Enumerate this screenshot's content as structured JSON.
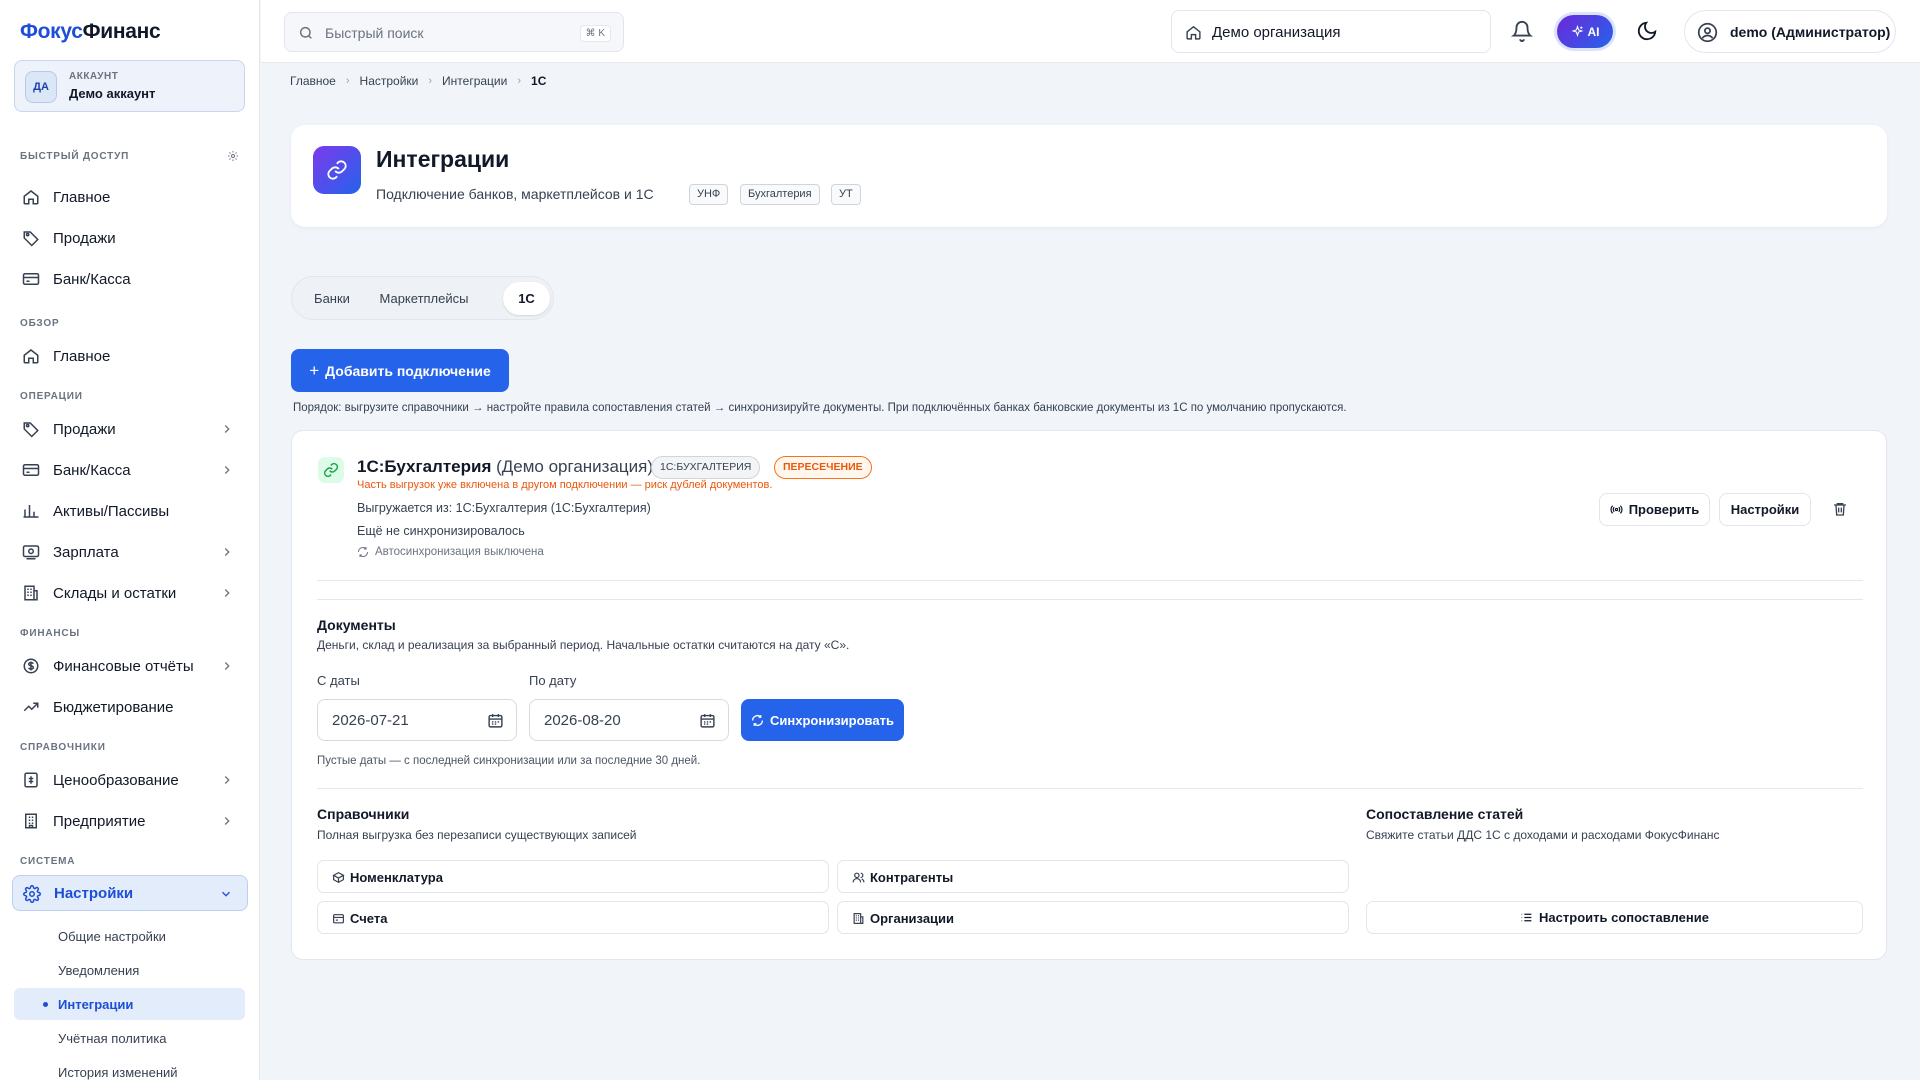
{
  "sidebar": {
    "logo_part1": "Фокус",
    "logo_part2": "Финанс",
    "account": {
      "avatar": "ДА",
      "label": "АККАУНТ",
      "name": "Демо аккаунт"
    },
    "sections": {
      "quick": "БЫСТРЫЙ ДОСТУП",
      "overview": "ОБЗОР",
      "operations": "ОПЕРАЦИИ",
      "finance": "ФИНАНСЫ",
      "references": "СПРАВОЧНИКИ",
      "system": "СИСТЕМА"
    },
    "quick": [
      "Главное",
      "Продажи",
      "Банк/Касса"
    ],
    "overview": [
      "Главное"
    ],
    "operations": [
      "Продажи",
      "Банк/Касса",
      "Активы/Пассивы",
      "Зарплата",
      "Склады и остатки"
    ],
    "finance": [
      "Финансовые отчёты",
      "Бюджетирование"
    ],
    "references": [
      "Ценообразование",
      "Предприятие"
    ],
    "system": [
      "Настройки"
    ],
    "settings_sub": [
      "Общие настройки",
      "Уведомления",
      "Интеграции",
      "Учётная политика",
      "История изменений"
    ],
    "icons": {
      "home": "home-icon",
      "tag": "tag-icon",
      "bank": "card-icon",
      "assets": "bar-chart-icon",
      "salary": "payroll-icon",
      "warehouse": "building-icon",
      "reports": "dollar-circle-icon",
      "budget": "trend-up-icon",
      "pricing": "price-tag-icon",
      "enterprise": "enterprise-icon",
      "settings": "gear-icon"
    }
  },
  "topbar": {
    "search_placeholder": "Быстрый поиск",
    "search_kbd": "⌘ K",
    "organization": "Демо организация",
    "ai_label": "AI",
    "user": "demo (Администратор)"
  },
  "breadcrumb": [
    "Главное",
    "Настройки",
    "Интеграции",
    "1С"
  ],
  "header": {
    "title": "Интеграции",
    "subtitle": "Подключение банков, маркетплейсов и 1С",
    "tags": [
      "УНФ",
      "Бухгалтерия",
      "УТ"
    ]
  },
  "tabs": {
    "items": [
      "Банки",
      "Маркетплейсы",
      "1С"
    ],
    "active": "1С"
  },
  "actions": {
    "add_connection": "Добавить подключение",
    "order_note": "Порядок: выгрузите справочники → настройте правила сопоставления статей → синхронизируйте документы. При подключённых банках банковские документы из 1С по умолчанию пропускаются."
  },
  "connection": {
    "title": "1С:Бухгалтерия",
    "title_org": "(Демо организация)",
    "badge_type": "1С:БУХГАЛТЕРИЯ",
    "badge_status": "ПЕРЕСЕЧЕНИЕ",
    "warning": "Часть выгрузок уже включена в другом подключении — риск дублей документов.",
    "source": "Выгружается из: 1С:Бухгалтерия (1С:Бухгалтерия)",
    "sync_status": "Ещё не синхронизировалось",
    "autosync": "Автосинхронизация выключена",
    "check_button": "Проверить",
    "settings_button": "Настройки",
    "status_color": "#ea580c"
  },
  "documents": {
    "title": "Документы",
    "desc": "Деньги, склад и реализация за выбранный период. Начальные остатки считаются на дату «С».",
    "from_label": "С даты",
    "to_label": "По дату",
    "from_value": "2026-07-21",
    "to_value": "2026-08-20",
    "sync_button": "Синхронизировать",
    "hint": "Пустые даты — с последней синхронизации или за последние 30 дней."
  },
  "directories": {
    "title": "Справочники",
    "desc": "Полная выгрузка без перезаписи существующих записей",
    "items": [
      "Номенклатура",
      "Контрагенты",
      "Счета",
      "Организации"
    ]
  },
  "mapping": {
    "title": "Сопоставление статей",
    "desc": "Свяжите статьи ДДС 1С с доходами и расходами ФокусФинанс",
    "button": "Настроить сопоставление"
  },
  "colors": {
    "accent": "#2563eb",
    "brand": "#1d4ed8",
    "warning": "#ea580c",
    "success": "#16a34a"
  }
}
